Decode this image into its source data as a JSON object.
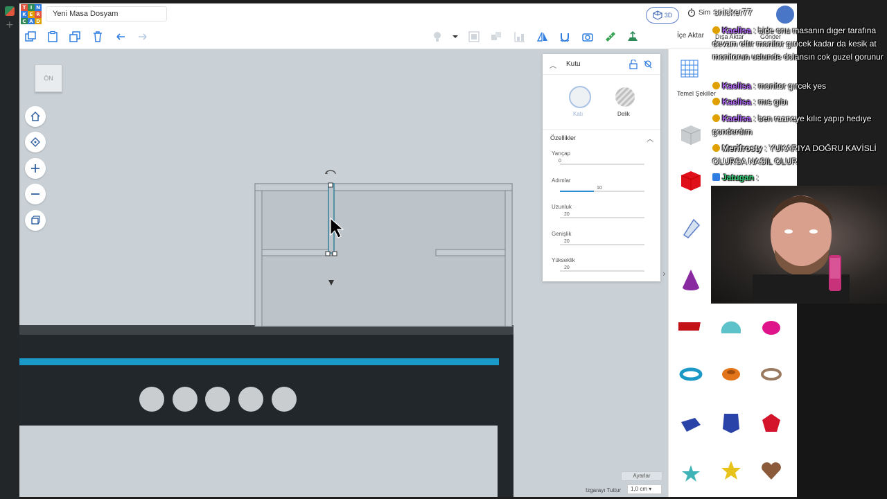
{
  "app": {
    "logo_letters": [
      "T",
      "I",
      "N",
      "K",
      "E",
      "R",
      "C",
      "A",
      "D"
    ],
    "document_title": "Yeni Masa Dosyam",
    "mode_label": "3D",
    "sim_label": "Sim",
    "colors": {
      "accent": "#2a8fd6",
      "logo_a": "#e0533c",
      "logo_b": "#2e8b57",
      "logo_c": "#2f7de1"
    }
  },
  "toolbar": {
    "tools": [
      "copy-icon",
      "paste-icon",
      "duplicate-icon",
      "delete-icon",
      "undo-icon",
      "redo-icon"
    ],
    "right_tools": [
      "light-icon",
      "chevron-down-icon",
      "group-icon",
      "ungroup-icon",
      "align-icon",
      "mirror-icon",
      "magnet-icon",
      "camera-icon",
      "ruler-icon",
      "workplane-icon"
    ],
    "import_label": "İçe Aktar",
    "export_label": "Dışa Aktar",
    "send_label": "Gönder"
  },
  "viewport": {
    "view_cube_label": "ÖN",
    "nav": [
      "home-icon",
      "fit-icon",
      "zoom-in-icon",
      "zoom-out-icon",
      "ortho-icon"
    ],
    "settings_label": "Ayarlar",
    "grid_label": "Izgarayı Tuttur",
    "grid_value": "1,0 cm"
  },
  "inspector": {
    "title": "Kutu",
    "solid_label": "Katı",
    "hole_label": "Delik",
    "section_title": "Özellikler",
    "props": [
      {
        "name": "Yarıçap",
        "value": "0",
        "fill": 0
      },
      {
        "name": "Adımlar",
        "value": "10",
        "fill": 0.4
      },
      {
        "name": "Uzunluk",
        "value": "20",
        "fill": 0
      },
      {
        "name": "Genişlik",
        "value": "20",
        "fill": 0
      },
      {
        "name": "Yükseklik",
        "value": "20",
        "fill": 0
      }
    ]
  },
  "shapes": {
    "category": "Temel Şekiller"
  },
  "stream": {
    "top_user": "snicker77",
    "messages": [
      {
        "user": "Kaelisa",
        "text": ": bide onu masanın dıger tarafına devam ettır monitor gırıcek kadar da kesik at monitorun ustunde dolansın cok guzel gorunur"
      },
      {
        "user": "Kaelisa",
        "text": ": monitor gırcek yes"
      },
      {
        "user": "Kaelisa",
        "text": ": mıs gıbı"
      },
      {
        "user": "Kaelisa",
        "text": ": ben raaneye kılıc yapıp hedıye gonderdım"
      },
      {
        "user": "Merifrosty",
        "text": ": YUKARIYA DOĞRU KAVİSLİ OLURSA NASIL OLUR"
      },
      {
        "user": "Jatugan",
        "text": ":"
      }
    ]
  }
}
